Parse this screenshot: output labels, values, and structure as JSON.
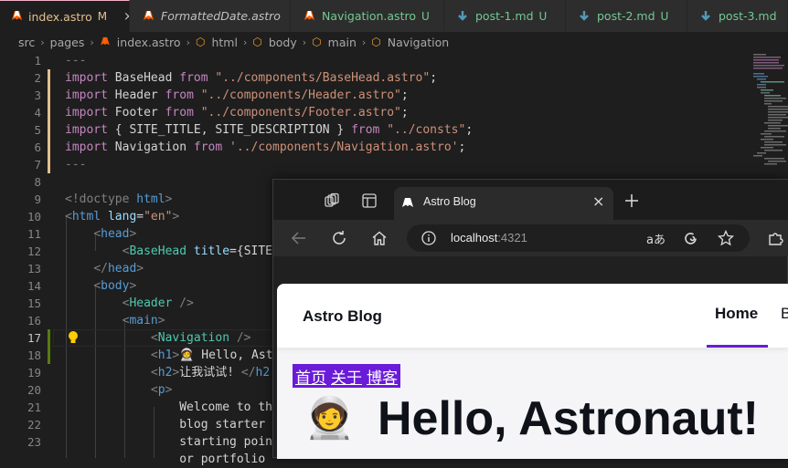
{
  "editor_tabs": [
    {
      "name": "index.astro",
      "status": "M",
      "kind": "astro",
      "state": "active"
    },
    {
      "name": "FormattedDate.astro",
      "status": "",
      "kind": "astro",
      "state": "normal"
    },
    {
      "name": "Navigation.astro",
      "status": "U",
      "kind": "astro",
      "state": "untracked"
    },
    {
      "name": "post-1.md",
      "status": "U",
      "kind": "md",
      "state": "untracked"
    },
    {
      "name": "post-2.md",
      "status": "U",
      "kind": "md",
      "state": "untracked"
    },
    {
      "name": "post-3.md",
      "status": "",
      "kind": "md",
      "state": "untracked"
    }
  ],
  "tab_close": "×",
  "breadcrumb": [
    "src",
    "pages",
    "index.astro",
    "html",
    "body",
    "main",
    "Navigation"
  ],
  "line_numbers": [
    "1",
    "2",
    "3",
    "4",
    "5",
    "6",
    "7",
    "8",
    "9",
    "10",
    "11",
    "12",
    "13",
    "14",
    "15",
    "16",
    "17",
    "18",
    "19",
    "20",
    "21",
    "22",
    "23"
  ],
  "current_line": "17",
  "code": {
    "l1": "---",
    "l2": {
      "kw": "import",
      "name": " BaseHead ",
      "from": "from",
      "str": " \"../components/BaseHead.astro\"",
      "end": ";"
    },
    "l3": {
      "kw": "import",
      "name": " Header ",
      "from": "from",
      "str": " \"../components/Header.astro\"",
      "end": ";"
    },
    "l4": {
      "kw": "import",
      "name": " Footer ",
      "from": "from",
      "str": " \"../components/Footer.astro\"",
      "end": ";"
    },
    "l5": {
      "kw": "import",
      "name": " { SITE_TITLE, SITE_DESCRIPTION } ",
      "from": "from",
      "str": " \"../consts\"",
      "end": ";"
    },
    "l6": {
      "kw": "import",
      "name": " Navigation ",
      "from": "from",
      "str": " '../components/Navigation.astro'",
      "end": ";"
    },
    "l7": "---",
    "l9a": "<!doctype ",
    "l9b": "html",
    "l9c": ">",
    "l10a": "<",
    "l10b": "html",
    "l10c": " lang",
    "l10d": "=",
    "l10e": "\"en\"",
    "l10f": ">",
    "l11a": "<",
    "l11b": "head",
    "l11c": ">",
    "l12a": "<",
    "l12b": "BaseHead",
    "l12c": " title",
    "l12d": "={SITE_",
    "l13a": "</",
    "l13b": "head",
    "l13c": ">",
    "l14a": "<",
    "l14b": "body",
    "l14c": ">",
    "l15a": "<",
    "l15b": "Header",
    "l15c": " />",
    "l16a": "<",
    "l16b": "main",
    "l16c": ">",
    "l17a": "<",
    "l17b": "Navigation",
    "l17c": " />",
    "l18a": "<",
    "l18b": "h1",
    "l18c": ">",
    "l18d": "🧑‍🚀 Hello, Ast",
    "l19a": "<",
    "l19b": "h2",
    "l19c": ">",
    "l19d": "让我试试! ",
    "l19e": "</",
    "l19f": "h2",
    "l20a": "<",
    "l20b": "p",
    "l20c": ">",
    "l21": "Welcome to the",
    "l22": "blog starter t",
    "l23": "starting point",
    "l24": "or portfolio"
  },
  "browser": {
    "tab_title": "Astro Blog",
    "url_host": "localhost",
    "url_port": ":4321",
    "read_aloud": "aあ"
  },
  "site": {
    "brand": "Astro Blog",
    "nav_home": "Home",
    "nav_next": "B",
    "nav_links": [
      "首页",
      "关于",
      "博客"
    ],
    "hero_emoji": "🧑‍🚀",
    "hero_title": "Hello, Astronaut!"
  },
  "colors": {
    "accent": "#6a1bd8",
    "link_text": "#ffffff"
  }
}
